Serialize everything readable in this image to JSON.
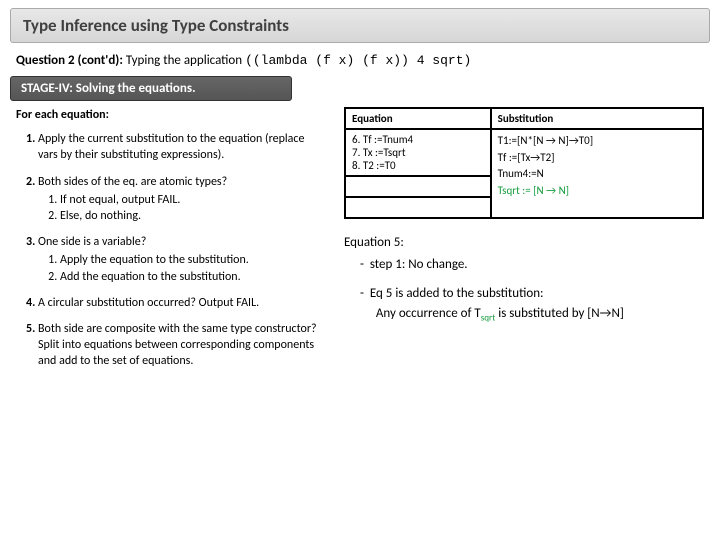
{
  "title": "Type Inference using Type Constraints",
  "question_label": "Question 2 (cont'd):",
  "question_text": "Typing the application",
  "question_code": "((lambda (f x)  (f x)) 4 sqrt)",
  "stage": "STAGE-IV: Solving the equations.",
  "lead": "For each equation:",
  "steps": [
    {
      "t": "Apply the current substitution to the equation (replace vars by their substituting expressions).",
      "sub": []
    },
    {
      "t": "Both sides of the eq. are atomic types?",
      "sub": [
        "If not equal, output FAIL.",
        "Else, do nothing."
      ]
    },
    {
      "t": "One side is a variable?",
      "sub": [
        "Apply the equation to the substitution.",
        "Add the equation to the substitution."
      ]
    },
    {
      "t": "A circular substitution occurred? Output FAIL.",
      "sub": []
    },
    {
      "t": "Both side are composite with the same type constructor? Split into equations between corresponding components and add to the set of equations.",
      "sub": []
    }
  ],
  "table": {
    "head": [
      "Equation",
      "Substitution"
    ],
    "eq_lines": [
      "6. Tf :=Tnum4",
      "7. Tx :=Tsqrt",
      "8. T2 :=T0"
    ],
    "sub_lines": [
      "T1:=[N*[N → N]→T0]",
      "Tf :=[Tx→T2]",
      "Tnum4:=N",
      "Tsqrt := [N → N]"
    ]
  },
  "notes": {
    "header": "Equation 5:",
    "b1": "step 1: No change.",
    "b2a": "Eq 5 is added to the substitution:",
    "b2b_pre": "Any occurrence of T",
    "b2b_sub": "sqrt",
    "b2b_post": " is substituted by [N→N]"
  }
}
